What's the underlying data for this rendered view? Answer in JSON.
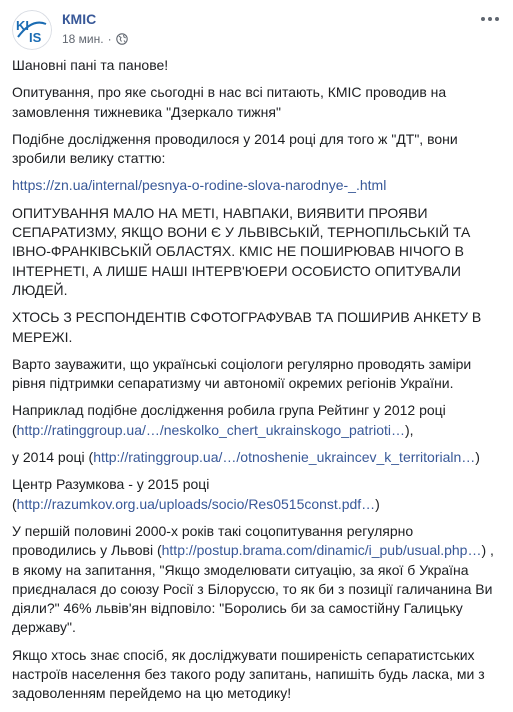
{
  "post": {
    "page_name": "КМІС",
    "timestamp": "18 мин.",
    "privacy_icon": "globe-icon",
    "more_icon": "more-options-icon",
    "greeting": "Шановні пані та панове!",
    "p1": "Опитування, про яке сьогодні в нас всі питають, КМІС проводив на замовлення тижневика \"Дзеркало тижня\"",
    "p2": "Подібне дослідження проводилося у 2014 році для того ж \"ДТ\", вони зробили велику статтю:",
    "link1": "https://zn.ua/internal/pesnya-o-rodine-slova-narodnye-_.html",
    "caps1": "ОПИТУВАННЯ МАЛО НА МЕТІ, НАВПАКИ, ВИЯВИТИ ПРОЯВИ СЕПАРАТИЗМУ, ЯКЩО ВОНИ Є У ЛЬВІВСЬКІЙ, ТЕРНОПІЛЬСЬКІЙ ТА ІВНО-ФРАНКІВСЬКІЙ ОБЛАСТЯХ. КМІС НЕ ПОШИРЮВАВ НІЧОГО В ІНТЕРНЕТІ, А ЛИШЕ НАШІ ІНТЕРВ'ЮЕРИ ОСОБИСТО ОПИТУВАЛИ ЛЮДЕЙ.",
    "caps2": "ХТОСЬ З РЕСПОНДЕНТІВ СФОТОГРАФУВАВ ТА ПОШИРИВ АНКЕТУ В МЕРЕЖІ.",
    "p3": "Варто зауважити, що українські соціологи регулярно проводять заміри рівня підтримки сепаратизму чи автономії окремих регіонів України.",
    "p4_text": "Наприклад подібне дослідження робила група Рейтинг у 2012 році (",
    "p4_link": "http://ratinggroup.ua/…/neskolko_chert_ukrainskogo_patrioti…",
    "p4_end": "),",
    "p5_text": "у 2014 році (",
    "p5_link": "http://ratinggroup.ua/…/otnoshenie_ukraincev_k_territorialn…",
    "p5_end": ")",
    "p6_text": "Центр Разумкова - у 2015 році (",
    "p6_link": "http://razumkov.org.ua/uploads/socio/Res0515const.pdf…",
    "p6_end": ")",
    "p7_text_a": "У першій половині 2000-х років такі соцопитування регулярно проводились у Львові (",
    "p7_link": "http://postup.brama.com/dinamic/i_pub/usual.php…",
    "p7_text_b": ") , в якому на запитання, \"Якщо змоделювати ситуацію, за якої б Україна приєдналася до союзу Росії з Білоруссю, то як би з позиції галичанина Ви діяли?\" 46% львів'ян відповіло: \"Боролись би за самостійну Галицьку державу\".",
    "p8": "Якщо хтось знає спосіб, як досліджувати поширеність сепаратистських настроїв населення без такого роду запитань, напишіть будь ласка, ми з задоволенням перейдемо на цю методику!"
  }
}
